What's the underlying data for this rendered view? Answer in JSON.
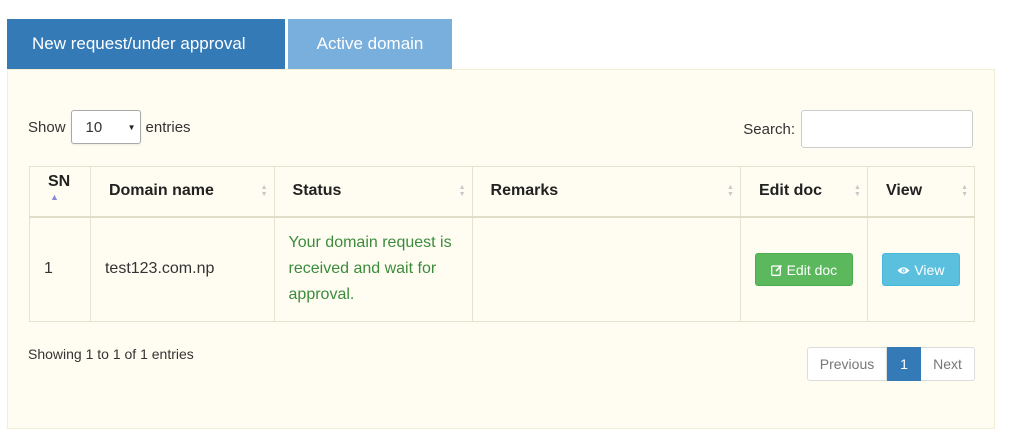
{
  "tabs": [
    {
      "label": "New request/under approval"
    },
    {
      "label": "Active domain"
    }
  ],
  "length_menu": {
    "prefix": "Show",
    "value": "10",
    "suffix": "entries"
  },
  "search": {
    "label": "Search:",
    "value": ""
  },
  "table": {
    "headers": [
      "SN",
      "Domain name",
      "Status",
      "Remarks",
      "Edit doc",
      "View"
    ],
    "rows": [
      {
        "sn": "1",
        "domain": "test123.com.np",
        "status": "Your domain request is received and wait for approval.",
        "remarks": "",
        "edit_label": "Edit doc",
        "view_label": "View"
      }
    ]
  },
  "info": "Showing 1 to 1 of 1 entries",
  "pagination": {
    "previous": "Previous",
    "current": "1",
    "next": "Next"
  },
  "colors": {
    "primary": "#337ab7",
    "tab_inactive": "#79afdc",
    "panel_bg": "#fffdf2",
    "success": "#5cb85c",
    "info": "#5bc0de",
    "status_text": "#3c8b3c"
  }
}
